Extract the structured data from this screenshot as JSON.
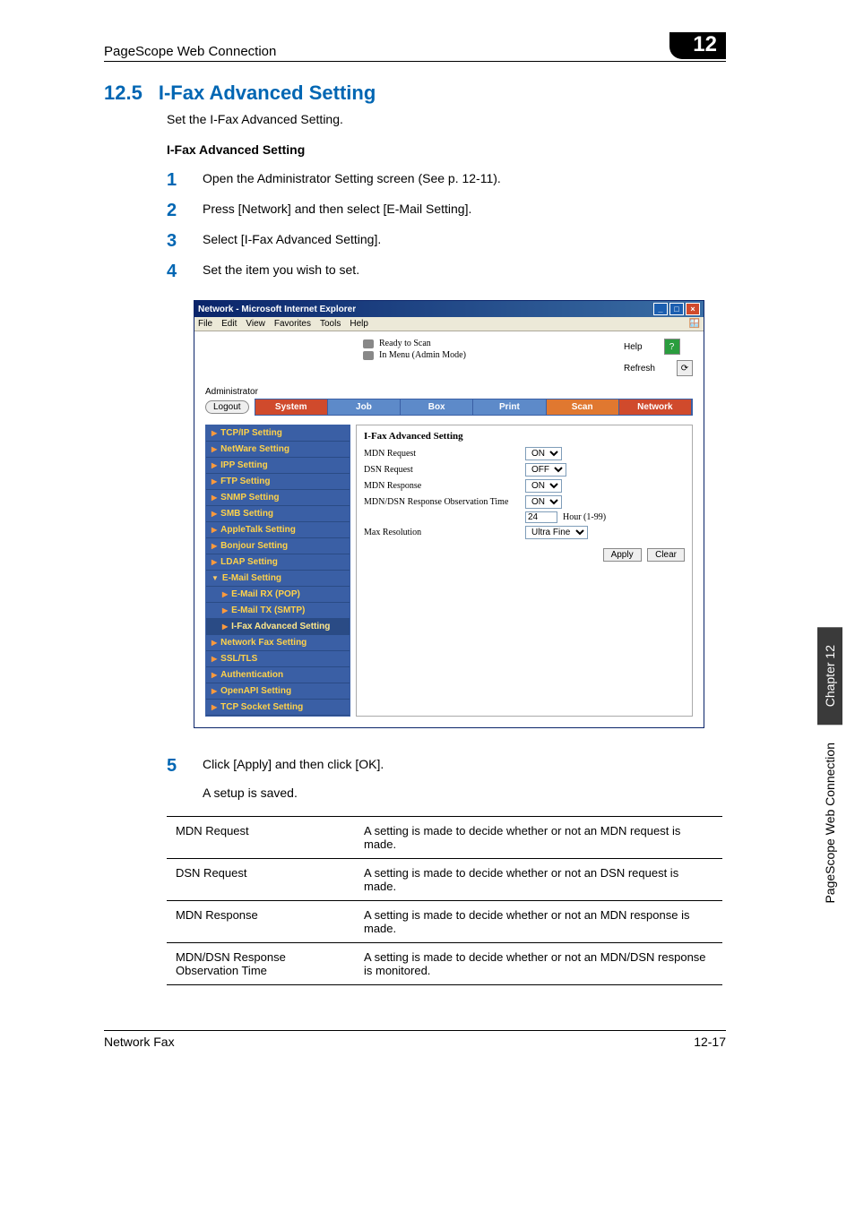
{
  "running_head": {
    "title": "PageScope Web Connection",
    "chapter_badge": "12"
  },
  "section": {
    "number": "12.5",
    "title": "I-Fax Advanced Setting"
  },
  "intro_text": "Set the I-Fax Advanced Setting.",
  "sub_heading": "I-Fax Advanced Setting",
  "steps": [
    {
      "num": "1",
      "text": "Open the Administrator Setting screen (See p. 12-11)."
    },
    {
      "num": "2",
      "text": "Press [Network] and then select [E-Mail Setting]."
    },
    {
      "num": "3",
      "text": "Select [I-Fax Advanced Setting]."
    },
    {
      "num": "4",
      "text": "Set the item you wish to set."
    }
  ],
  "step5": {
    "num": "5",
    "text": "Click [Apply] and then click [OK].",
    "sub": "A setup is saved."
  },
  "screenshot": {
    "window_title": "Network - Microsoft Internet Explorer",
    "menubar": [
      "File",
      "Edit",
      "View",
      "Favorites",
      "Tools",
      "Help"
    ],
    "status_lines": [
      "Ready to Scan",
      "In Menu (Admin Mode)"
    ],
    "help_label": "Help",
    "refresh_label": "Refresh",
    "admin_label": "Administrator",
    "logout_label": "Logout",
    "tabs": [
      "System",
      "Job",
      "Box",
      "Print",
      "Scan",
      "Network"
    ],
    "sidemenu": [
      {
        "label": "TCP/IP Setting"
      },
      {
        "label": "NetWare Setting"
      },
      {
        "label": "IPP Setting"
      },
      {
        "label": "FTP Setting"
      },
      {
        "label": "SNMP Setting"
      },
      {
        "label": "SMB Setting"
      },
      {
        "label": "AppleTalk Setting"
      },
      {
        "label": "Bonjour Setting"
      },
      {
        "label": "LDAP Setting"
      },
      {
        "label": "E-Mail Setting",
        "expanded": true,
        "children": [
          {
            "label": "E-Mail RX (POP)"
          },
          {
            "label": "E-Mail TX (SMTP)"
          },
          {
            "label": "I-Fax Advanced Setting",
            "active": true
          }
        ]
      },
      {
        "label": "Network Fax Setting"
      },
      {
        "label": "SSL/TLS"
      },
      {
        "label": "Authentication"
      },
      {
        "label": "OpenAPI Setting"
      },
      {
        "label": "TCP Socket Setting"
      }
    ],
    "form": {
      "heading": "I-Fax Advanced Setting",
      "mdn_request_label": "MDN Request",
      "mdn_request_value": "ON",
      "dsn_request_label": "DSN Request",
      "dsn_request_value": "OFF",
      "mdn_response_label": "MDN Response",
      "mdn_response_value": "ON",
      "obs_label": "MDN/DSN Response Observation Time",
      "obs_select_value": "ON",
      "obs_hour_value": "24",
      "obs_hour_unit": "Hour (1-99)",
      "max_res_label": "Max Resolution",
      "max_res_value": "Ultra Fine",
      "apply_btn": "Apply",
      "clear_btn": "Clear"
    }
  },
  "settings_table": [
    {
      "name": "MDN Request",
      "desc": "A setting is made to decide whether or not an MDN request is made."
    },
    {
      "name": "DSN Request",
      "desc": "A setting is made to decide whether or not an DSN request is made."
    },
    {
      "name": "MDN Response",
      "desc": "A setting is made to decide whether or not an MDN response is made."
    },
    {
      "name": "MDN/DSN Response Observation Time",
      "desc": "A setting is made to decide whether or not an MDN/DSN response is monitored."
    }
  ],
  "side_tab": {
    "dark": "Chapter 12",
    "light": "PageScope Web Connection"
  },
  "footer": {
    "left": "Network Fax",
    "right": "12-17"
  }
}
